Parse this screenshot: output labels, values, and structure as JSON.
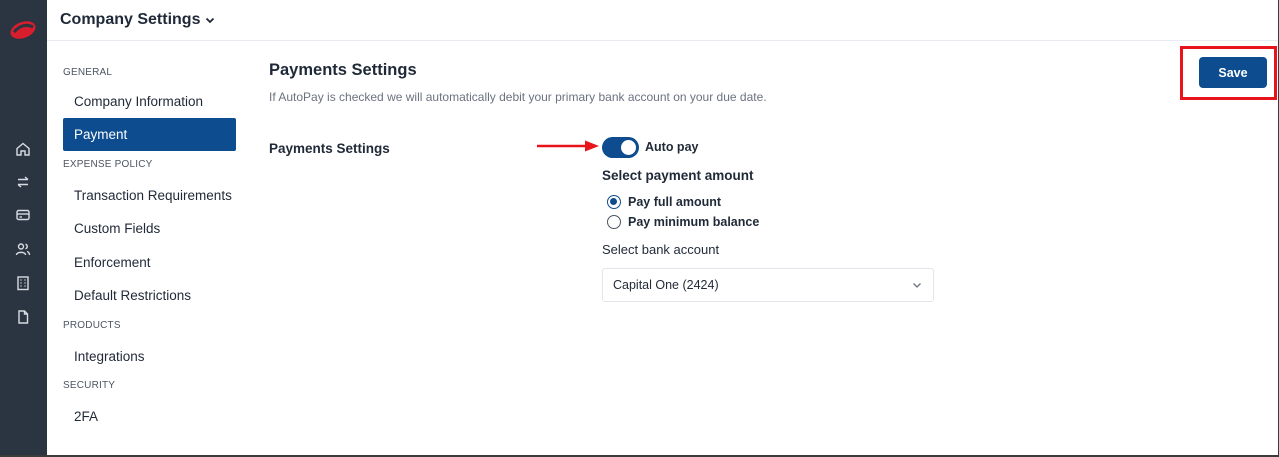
{
  "header": {
    "company_settings_label": "Company Settings"
  },
  "rail": {
    "icons": [
      "logo",
      "home-icon",
      "transfer-icon",
      "card-icon",
      "users-icon",
      "building-icon",
      "document-icon"
    ]
  },
  "sidebar": {
    "sections": [
      {
        "label": "GENERAL"
      },
      {
        "label": "EXPENSE POLICY"
      },
      {
        "label": "PRODUCTS"
      },
      {
        "label": "SECURITY"
      }
    ],
    "items": [
      {
        "label": "Company Information"
      },
      {
        "label": "Payment",
        "active": true
      },
      {
        "label": "Transaction Requirements"
      },
      {
        "label": "Custom Fields"
      },
      {
        "label": "Enforcement"
      },
      {
        "label": "Default Restrictions"
      },
      {
        "label": "Integrations"
      },
      {
        "label": "2FA"
      }
    ]
  },
  "main": {
    "title": "Payments Settings",
    "description": "If AutoPay is checked we will automatically debit your primary bank account on your due date.",
    "row_label": "Payments Settings",
    "autopay": {
      "label": "Auto pay",
      "enabled": true
    },
    "payment_amount": {
      "heading": "Select payment amount",
      "options": [
        {
          "label": "Pay full amount",
          "selected": true
        },
        {
          "label": "Pay minimum balance",
          "selected": false
        }
      ]
    },
    "bank_account": {
      "heading": "Select bank account",
      "selected": "Capital One (2424)"
    }
  },
  "toolbar": {
    "save_label": "Save"
  },
  "colors": {
    "primary": "#0d4c8e",
    "rail": "#2b3441",
    "annotation_red": "#e8131b",
    "brand_red": "#d81e2c"
  }
}
